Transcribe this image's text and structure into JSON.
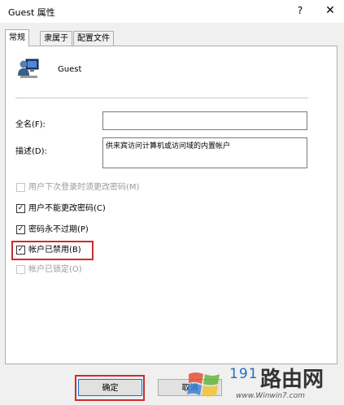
{
  "window": {
    "title": "Guest 属性",
    "help_label": "?",
    "close_label": "✕"
  },
  "tabs": [
    {
      "label": "常规"
    },
    {
      "label": "隶属于"
    },
    {
      "label": "配置文件"
    }
  ],
  "user": {
    "name": "Guest",
    "icon": "user-computer-icon"
  },
  "fields": {
    "fullname_label": "全名(F):",
    "fullname_value": "",
    "description_label": "描述(D):",
    "description_value": "供来宾访问计算机或访问域的内置帐户"
  },
  "options": [
    {
      "label": "用户下次登录时须更改密码(M)",
      "checked": false,
      "disabled": true
    },
    {
      "label": "用户不能更改密码(C)",
      "checked": true,
      "disabled": false
    },
    {
      "label": "密码永不过期(P)",
      "checked": true,
      "disabled": false
    },
    {
      "label": "帐户已禁用(B)",
      "checked": true,
      "disabled": false
    },
    {
      "label": "帐户已锁定(O)",
      "checked": false,
      "disabled": true
    }
  ],
  "buttons": {
    "ok_label": "确定",
    "cancel_label": "取消"
  },
  "watermark": {
    "number": "191",
    "chinese": "路由网",
    "url": "www.Winwin7.com"
  },
  "colors": {
    "highlight": "#d12a2a",
    "accent": "#0078d7"
  }
}
